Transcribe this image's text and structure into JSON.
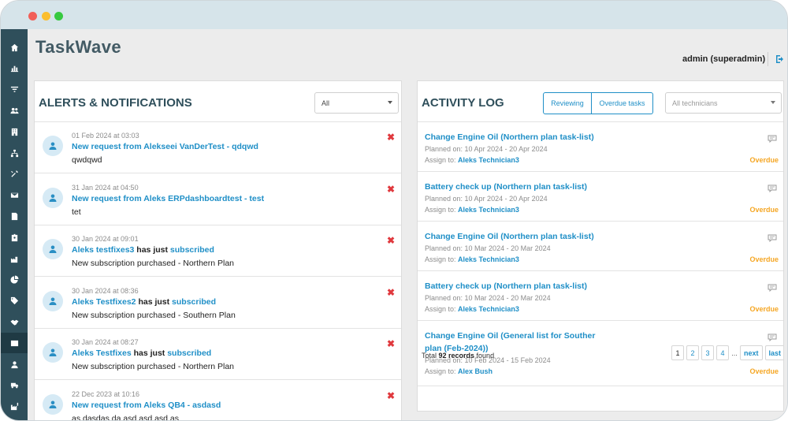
{
  "app": {
    "brand": "TaskWave",
    "user": "admin (superadmin)"
  },
  "sidebar": {
    "items": [
      {
        "icon": "home-icon"
      },
      {
        "icon": "bar-chart-icon"
      },
      {
        "icon": "filter-icon"
      },
      {
        "icon": "users-icon"
      },
      {
        "icon": "building-icon"
      },
      {
        "icon": "sitemap-icon"
      },
      {
        "icon": "tools-icon"
      },
      {
        "icon": "envelope-icon"
      },
      {
        "icon": "document-icon"
      },
      {
        "icon": "id-badge-icon"
      },
      {
        "icon": "factory-icon"
      },
      {
        "icon": "pie-chart-icon"
      },
      {
        "icon": "tags-icon"
      },
      {
        "icon": "handshake-icon"
      },
      {
        "icon": "window-icon"
      },
      {
        "icon": "user-icon"
      },
      {
        "icon": "truck-icon"
      },
      {
        "icon": "industry-icon"
      }
    ]
  },
  "alerts": {
    "title": "ALERTS & NOTIFICATIONS",
    "filter_value": "All",
    "close_glyph": "✖",
    "items": [
      {
        "time": "01 Feb 2024 at 03:03",
        "link": "New request from Alekseei VanDerTest - qdqwd",
        "mid": "",
        "link2": "",
        "body": "qwdqwd"
      },
      {
        "time": "31 Jan 2024 at 04:50",
        "link": "New request from Aleks ERPdashboardtest - test",
        "mid": "",
        "link2": "",
        "body": "tet"
      },
      {
        "time": "30 Jan 2024 at 09:01",
        "link": "Aleks testfixes3",
        "mid": " has just ",
        "link2": "subscribed",
        "body": "New subscription purchased - Northern Plan"
      },
      {
        "time": "30 Jan 2024 at 08:36",
        "link": "Aleks Testfixes2",
        "mid": " has just ",
        "link2": "subscribed",
        "body": "New subscription purchased - Southern Plan"
      },
      {
        "time": "30 Jan 2024 at 08:27",
        "link": "Aleks Testfixes",
        "mid": " has just ",
        "link2": "subscribed",
        "body": "New subscription purchased - Northern Plan"
      },
      {
        "time": "22 Dec 2023 at 10:16",
        "link": "New request from Aleks QB4 - asdasd",
        "mid": "",
        "link2": "",
        "body": "as dasdas da asd asd asd as"
      }
    ]
  },
  "activity": {
    "title": "ACTIVITY LOG",
    "tabs": [
      "Reviewing",
      "Overdue tasks"
    ],
    "technician_placeholder": "All technicians",
    "items": [
      {
        "title": "Change Engine Oil (Northern plan task-list)",
        "planned": "Planned on: 10 Apr 2024 - 20 Apr 2024",
        "assign_label": "Assign to: ",
        "assignee": "Aleks Technician3",
        "status": "Overdue"
      },
      {
        "title": "Battery check up (Northern plan task-list)",
        "planned": "Planned on: 10 Apr 2024 - 20 Apr 2024",
        "assign_label": "Assign to: ",
        "assignee": "Aleks Technician3",
        "status": "Overdue"
      },
      {
        "title": "Change Engine Oil (Northern plan task-list)",
        "planned": "Planned on: 10 Mar 2024 - 20 Mar 2024",
        "assign_label": "Assign to: ",
        "assignee": "Aleks Technician3",
        "status": "Overdue"
      },
      {
        "title": "Battery check up (Northern plan task-list)",
        "planned": "Planned on: 10 Mar 2024 - 20 Mar 2024",
        "assign_label": "Assign to: ",
        "assignee": "Aleks Technician3",
        "status": "Overdue"
      },
      {
        "title": "Change Engine Oil (General list for Souther plan (Feb-2024))",
        "planned": "Planned on: 10 Feb 2024 - 15 Feb 2024",
        "assign_label": "Assign to: ",
        "assignee": "Alex Bush",
        "status": "Overdue"
      }
    ],
    "total_prefix": "Total ",
    "total_count": "92 records",
    "total_suffix": " found",
    "pages": [
      "1",
      "2",
      "3",
      "4"
    ],
    "ellipsis": "...",
    "next": "next",
    "last": "last"
  },
  "colors": {
    "accent": "#1f8fc7",
    "sidebar": "#2f4f5b",
    "overdue": "#f5a623",
    "close": "#e0393e"
  }
}
